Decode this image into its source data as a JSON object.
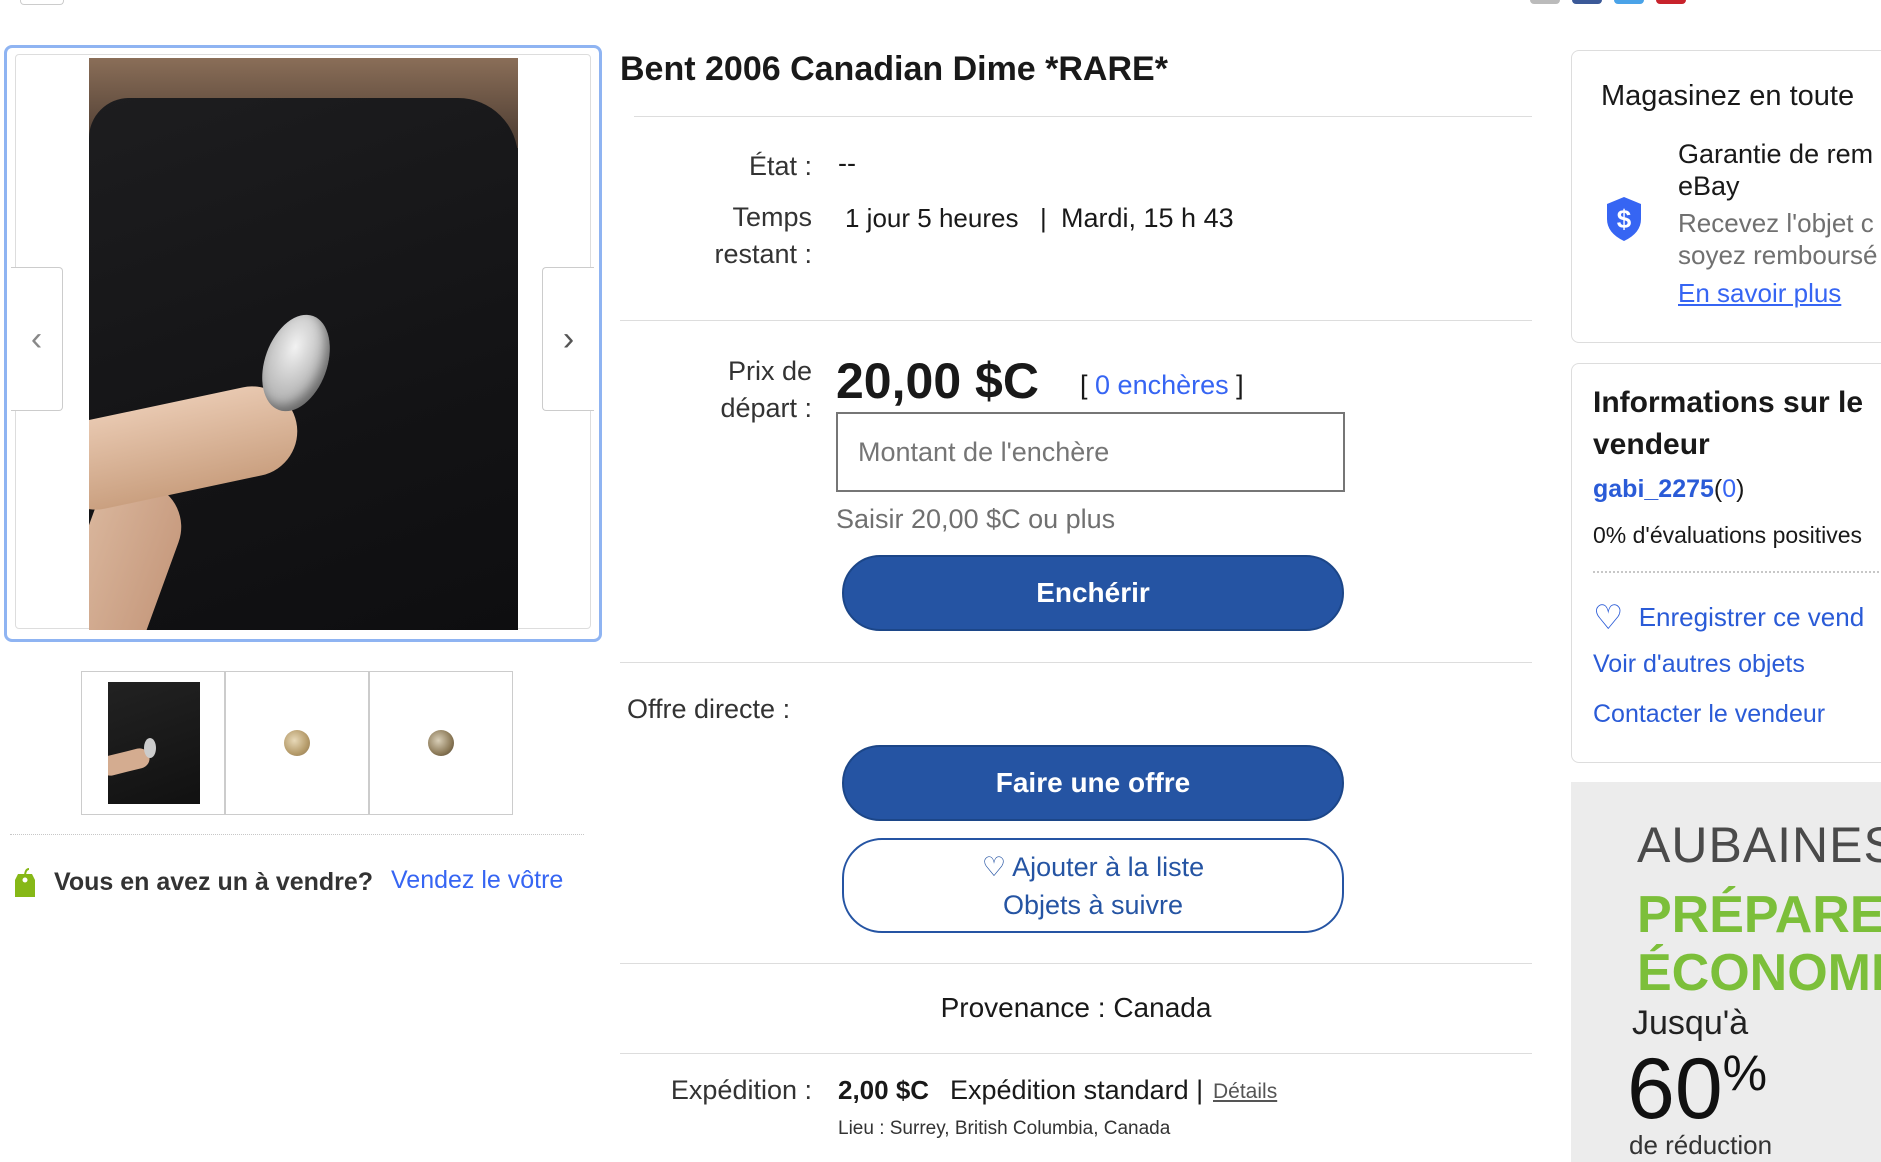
{
  "listing": {
    "title": "Bent 2006 Canadian Dime *RARE*",
    "condition_label": "État :",
    "condition_value": "--",
    "time_label_1": "Temps",
    "time_label_2": "restant :",
    "time_remaining": "1 jour 5  heures",
    "time_separator": "|",
    "end_time": "Mardi, 15 h 43",
    "start_price_label_1": "Prix de",
    "start_price_label_2": "départ :",
    "price": "20,00 $C",
    "bids_open": "[",
    "bids_link": "0 enchères",
    "bids_close": "]",
    "bid_placeholder": "Montant de l'enchère",
    "bid_hint": "Saisir 20,00 $C ou plus",
    "bid_button": "Enchérir",
    "best_offer_label": "Offre directe :",
    "offer_button": "Faire une offre",
    "watch_button_line1": "Ajouter à la liste",
    "watch_button_line2": "Objets à suivre",
    "origin": "Provenance : Canada",
    "shipping_label": "Expédition :",
    "shipping_amount": "2,00 $C",
    "shipping_type": "Expédition standard |",
    "shipping_details": "Détails",
    "location": "Lieu :  Surrey, British Columbia, Canada"
  },
  "gallery": {
    "prev_icon": "chevron-left-icon",
    "next_icon": "chevron-right-icon",
    "thumbnails": [
      "thumbnail-1",
      "thumbnail-2",
      "thumbnail-3"
    ]
  },
  "sell": {
    "text": "Vous en avez un à vendre?",
    "link": "Vendez le vôtre"
  },
  "guarantee": {
    "heading": "Magasinez en toute",
    "title_1": "Garantie de rem",
    "title_2": "eBay",
    "desc_1": "Recevez l'objet c",
    "desc_2": "soyez remboursé",
    "link": "En savoir plus"
  },
  "seller": {
    "heading_1": "Informations sur le",
    "heading_2": "vendeur",
    "name": "gabi_2275",
    "score_open": "(",
    "score": "0",
    "score_close": ")",
    "feedback": "0% d'évaluations positives",
    "save_seller": "Enregistrer ce vend",
    "other_items": "Voir d'autres objets",
    "contact": "Contacter le vendeur"
  },
  "ad": {
    "line1": "AUBAINES",
    "line2": "PRÉPAREZ-V",
    "line3": "ÉCONOMISE",
    "line4": "Jusqu'à",
    "line5": "60",
    "line6": "%",
    "line7": "de réduction"
  },
  "colors": {
    "primary": "#2554a3",
    "link": "#3665f3",
    "ad_green": "#7cbf3a"
  }
}
